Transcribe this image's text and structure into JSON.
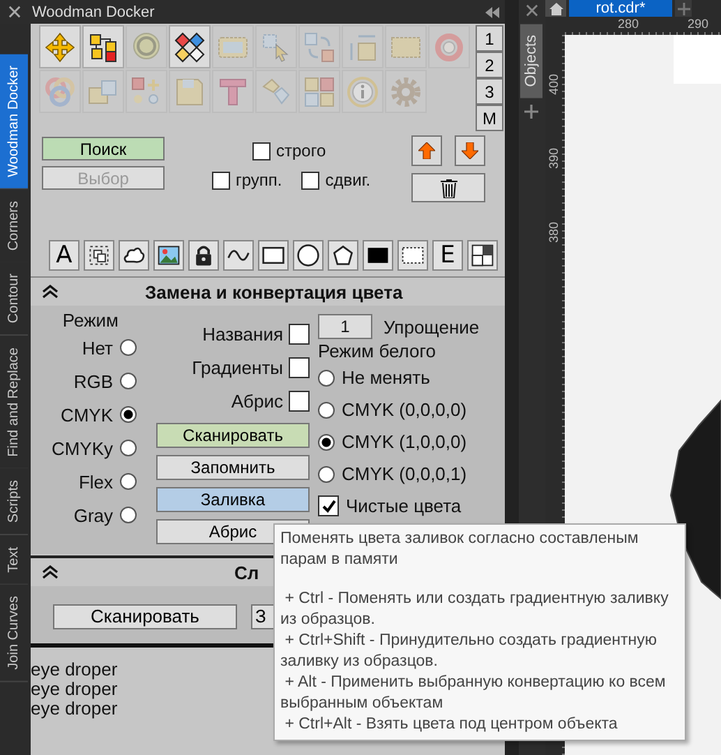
{
  "titlebar": {
    "title": "Woodman Docker"
  },
  "side_tabs": [
    {
      "label": "Woodman Docker",
      "selected": true
    },
    {
      "label": "Corners",
      "selected": false
    },
    {
      "label": "Contour",
      "selected": false
    },
    {
      "label": "Find and Replace",
      "selected": false
    },
    {
      "label": "Scripts",
      "selected": false
    },
    {
      "label": "Text",
      "selected": false
    },
    {
      "label": "Join Curves",
      "selected": false
    }
  ],
  "tool_grid": {
    "rows": [
      [
        {
          "disabled": false
        },
        {
          "disabled": false
        },
        {
          "disabled": true
        },
        {
          "disabled": false
        },
        {
          "disabled": true
        },
        {
          "disabled": true
        },
        {
          "disabled": true
        },
        {
          "disabled": true
        },
        {
          "disabled": true
        },
        {
          "disabled": true
        }
      ],
      [
        {
          "disabled": true
        },
        {
          "disabled": true
        },
        {
          "disabled": true
        },
        {
          "disabled": true
        },
        {
          "disabled": true
        },
        {
          "disabled": true
        },
        {
          "disabled": true
        },
        {
          "disabled": true
        },
        {
          "disabled": true
        }
      ]
    ]
  },
  "presets": [
    "1",
    "2",
    "3",
    "M"
  ],
  "search_button": {
    "label": "Поиск",
    "disabled": false
  },
  "select_button": {
    "label": "Выбор",
    "disabled": true
  },
  "options": [
    {
      "label": "строго",
      "checked": false
    },
    {
      "label": "групп.",
      "checked": false
    },
    {
      "label": "сдвиг.",
      "checked": false
    }
  ],
  "shape_tools": {
    "glyphs": [
      "A",
      "E"
    ]
  },
  "color_section": {
    "title": "Замена и конвертация цвета",
    "expanded": true,
    "mode_label": "Режим",
    "modes": [
      {
        "label": "Нет",
        "selected": false
      },
      {
        "label": "RGB",
        "selected": false
      },
      {
        "label": "CMYK",
        "selected": true
      },
      {
        "label": "CMYKy",
        "selected": false
      },
      {
        "label": "Flex",
        "selected": false
      },
      {
        "label": "Gray",
        "selected": false
      }
    ],
    "flags": [
      {
        "label": "Названия",
        "checked": false
      },
      {
        "label": "Градиенты",
        "checked": false
      },
      {
        "label": "Абрис",
        "checked": false
      }
    ],
    "buttons": [
      {
        "label": "Сканировать",
        "color": "#c8dcb4"
      },
      {
        "label": "Запомнить",
        "color": "#dedede"
      },
      {
        "label": "Заливка",
        "color": "#b4cde6"
      },
      {
        "label": "Абрис",
        "color": "#dedede"
      }
    ],
    "simplify": {
      "value": "1",
      "label": "Упрощение"
    },
    "white_mode_label": "Режим белого",
    "white_modes": [
      {
        "label": "Не менять",
        "selected": false
      },
      {
        "label": "CMYK (0,0,0,0)",
        "selected": false
      },
      {
        "label": "CMYK (1,0,0,0)",
        "selected": true
      },
      {
        "label": "CMYK (0,0,0,1)",
        "selected": false
      }
    ],
    "pure_colors": {
      "label": "Чистые цвета",
      "checked": true
    }
  },
  "sample_section": {
    "title": "Сл",
    "expanded": true,
    "buttons": [
      "Сканировать",
      "З"
    ]
  },
  "log": [
    "eye droper",
    "eye droper",
    "eye droper"
  ],
  "objects_panel": {
    "tab": "Objects"
  },
  "document_tabs": [
    {
      "label": "rot.cdr*",
      "selected": true
    }
  ],
  "ruler": {
    "x_labels": [
      "280",
      "290"
    ],
    "y_labels": [
      "400",
      "390",
      "380"
    ]
  },
  "tooltip": {
    "intro": "Поменять цвета заливок согласно составленым парам в памяти",
    "items": [
      " + Ctrl - Поменять или создать градиентную заливку из образцов.",
      " + Ctrl+Shift - Принудительно создать градиентную заливку из образцов.",
      " + Alt - Применить выбранную конвертацию ко всем выбранным объектам",
      " + Ctrl+Alt - Взять цвета под центром объекта"
    ]
  }
}
